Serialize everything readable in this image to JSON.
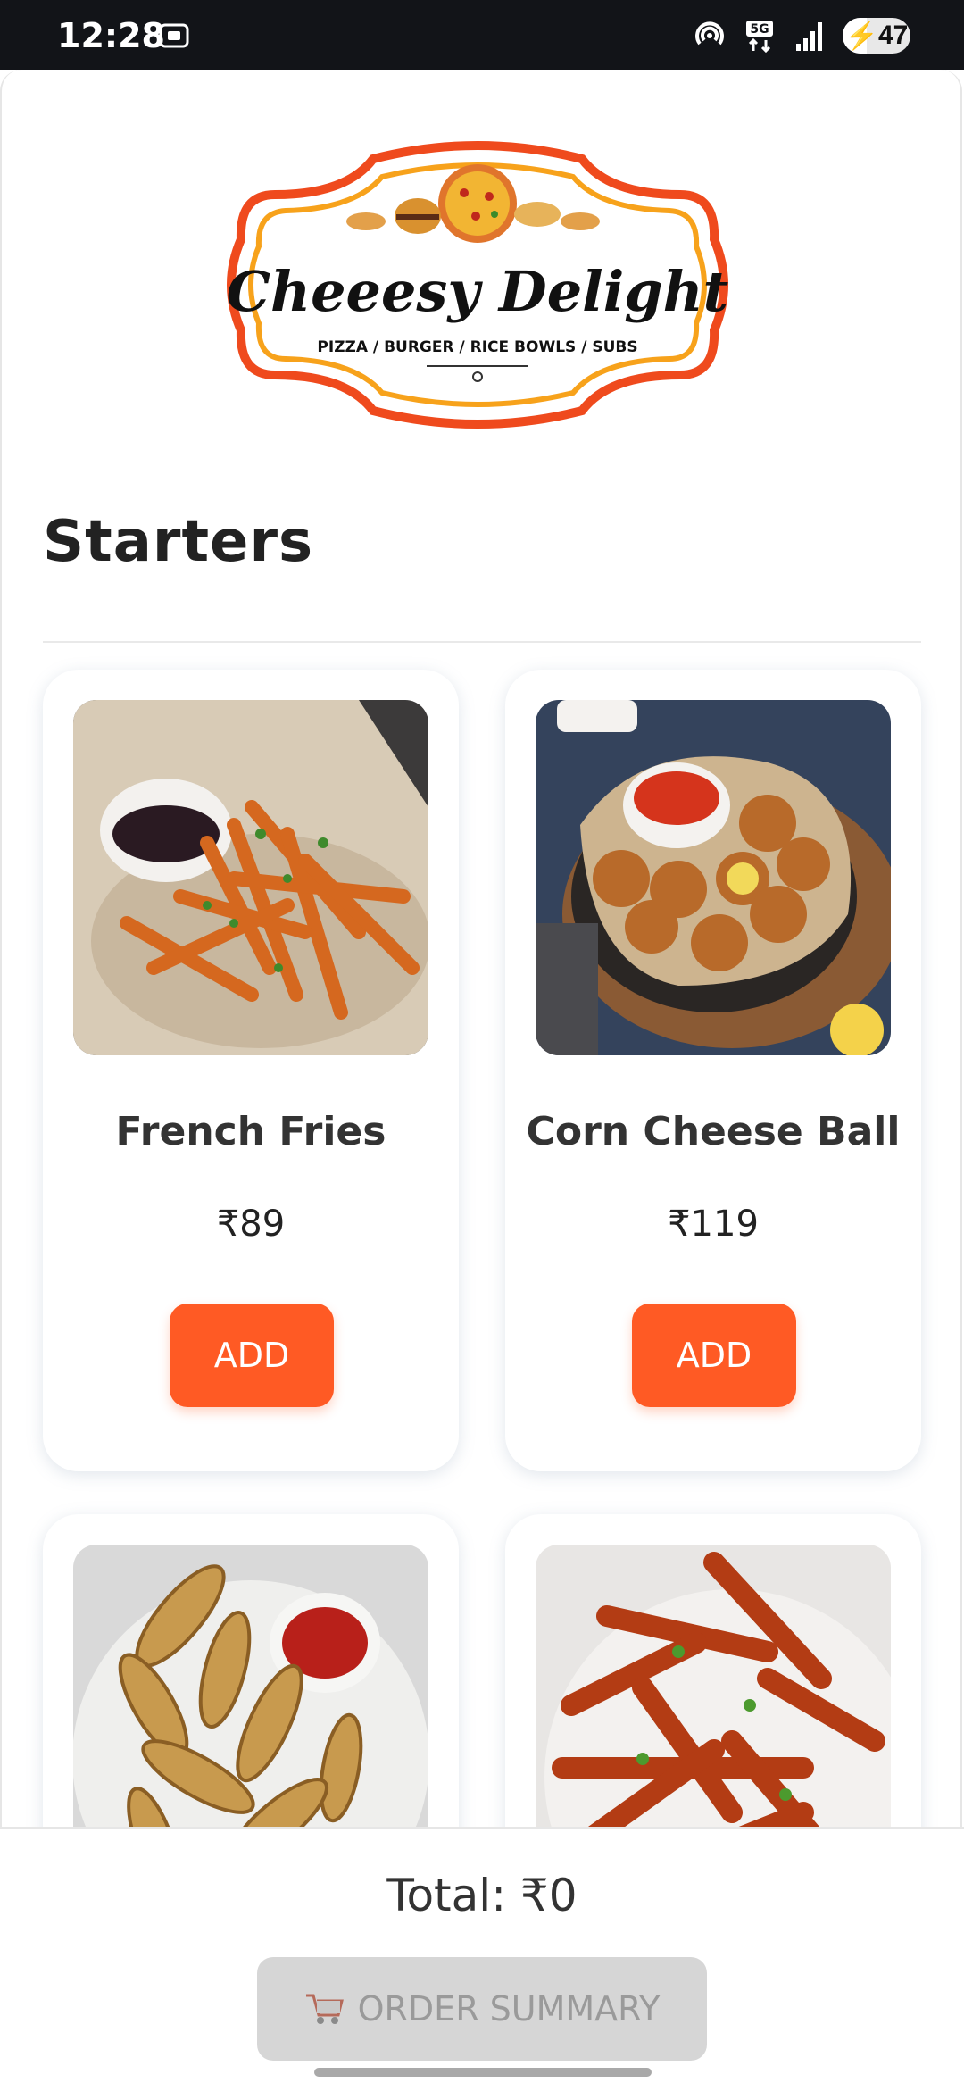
{
  "status_bar": {
    "time": "12:28",
    "battery": "47",
    "network": "5G"
  },
  "logo": {
    "name": "Cheeesy Delight",
    "tagline": "PIZZA / BURGER / RICE BOWLS / SUBS"
  },
  "section": {
    "title": "Starters"
  },
  "items": [
    {
      "name": "French Fries",
      "price": "₹89",
      "add_label": "ADD"
    },
    {
      "name": "Corn Cheese Ball",
      "price": "₹119",
      "add_label": "ADD"
    },
    {
      "name": "",
      "price": "",
      "add_label": ""
    },
    {
      "name": "",
      "price": "",
      "add_label": ""
    }
  ],
  "footer": {
    "total": "Total: ₹0",
    "order_button": "ORDER SUMMARY"
  },
  "colors": {
    "accent": "#ff5a24",
    "disabled": "#d6d6d6"
  }
}
